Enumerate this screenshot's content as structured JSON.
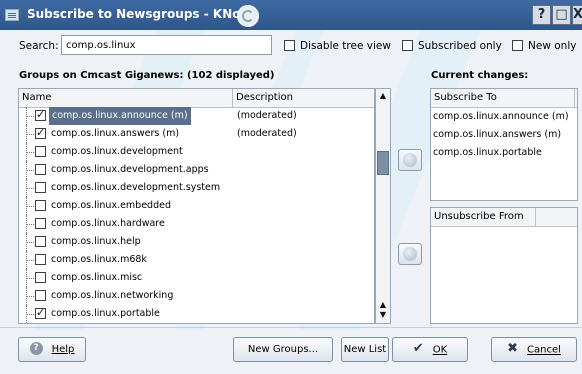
{
  "window": {
    "title": "Subscribe to Newsgroups - KNode",
    "title_buttons": [
      "?",
      "□",
      "X"
    ]
  },
  "search": {
    "label": "Search:",
    "value": "comp.os.linux"
  },
  "options": {
    "disable_tree_view": {
      "label": "Disable tree view",
      "checked": false
    },
    "subscribed_only": {
      "label": "Subscribed only",
      "checked": false
    },
    "new_only": {
      "label": "New only",
      "checked": false
    }
  },
  "groups": {
    "heading": "Groups on Cmcast Giganews: (102 displayed)",
    "columns": [
      "Name",
      "Description"
    ],
    "rows": [
      {
        "name": "comp.os.linux.announce (m)",
        "description": "(moderated)",
        "checked": true,
        "selected": true
      },
      {
        "name": "comp.os.linux.answers (m)",
        "description": "(moderated)",
        "checked": true,
        "selected": false
      },
      {
        "name": "comp.os.linux.development",
        "description": "",
        "checked": false,
        "selected": false
      },
      {
        "name": "comp.os.linux.development.apps",
        "description": "",
        "checked": false,
        "selected": false
      },
      {
        "name": "comp.os.linux.development.system",
        "description": "",
        "checked": false,
        "selected": false
      },
      {
        "name": "comp.os.linux.embedded",
        "description": "",
        "checked": false,
        "selected": false
      },
      {
        "name": "comp.os.linux.hardware",
        "description": "",
        "checked": false,
        "selected": false
      },
      {
        "name": "comp.os.linux.help",
        "description": "",
        "checked": false,
        "selected": false
      },
      {
        "name": "comp.os.linux.m68k",
        "description": "",
        "checked": false,
        "selected": false
      },
      {
        "name": "comp.os.linux.misc",
        "description": "",
        "checked": false,
        "selected": false
      },
      {
        "name": "comp.os.linux.networking",
        "description": "",
        "checked": false,
        "selected": false
      },
      {
        "name": "comp.os.linux.portable",
        "description": "",
        "checked": true,
        "selected": false
      }
    ]
  },
  "changes": {
    "heading": "Current changes:",
    "subscribe_header": "Subscribe To",
    "subscribe_items": [
      "comp.os.linux.announce (m)",
      "comp.os.linux.answers (m)",
      "comp.os.linux.portable"
    ],
    "unsubscribe_header": "Unsubscribe From",
    "unsubscribe_items": []
  },
  "buttons": {
    "help": "Help",
    "new_groups": "New Groups...",
    "new_list": "New List",
    "ok": "OK",
    "cancel": "Cancel"
  },
  "colors": {
    "titlebar": "#2e5689",
    "selection": "#5a6f8c",
    "background": "#eef2f7"
  }
}
